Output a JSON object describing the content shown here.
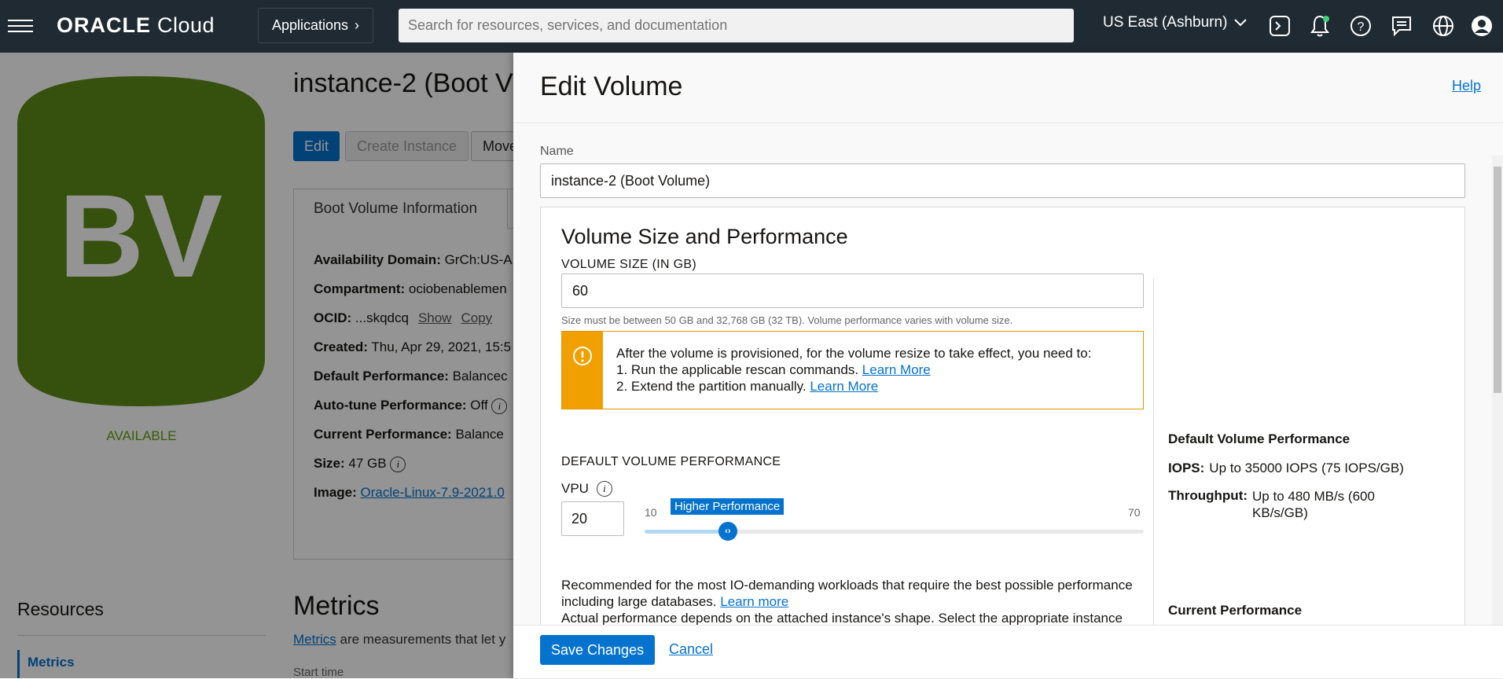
{
  "topbar": {
    "logo_bold": "ORACLE",
    "logo_rest": " Cloud",
    "applications_label": "Applications",
    "search_placeholder": "Search for resources, services, and documentation",
    "region": "US East (Ashburn)",
    "icons": [
      "cloud-shell-icon",
      "bell-icon",
      "help-icon",
      "chat-icon",
      "globe-icon",
      "user-icon"
    ]
  },
  "page": {
    "badge_text": "BV",
    "badge_color": "#5e8a17",
    "status": "AVAILABLE",
    "title": "instance-2 (Boot V",
    "buttons": {
      "edit": "Edit",
      "create_instance": "Create Instance",
      "move": "Move"
    },
    "tab": "Boot Volume Information",
    "info": {
      "ad_label": "Availability Domain:",
      "ad_value": " GrCh:US-A",
      "compartment_label": "Compartment:",
      "compartment_value": " ociobenablemen",
      "ocid_label": "OCID:",
      "ocid_value": " ...skqdcq",
      "ocid_show": "Show",
      "ocid_copy": "Copy",
      "created_label": "Created:",
      "created_value": " Thu, Apr 29, 2021, 15:5",
      "default_perf_label": "Default Performance:",
      "default_perf_value": " Balancec",
      "autotune_label": "Auto-tune Performance:",
      "autotune_value": " Off",
      "current_perf_label": "Current Performance:",
      "current_perf_value": " Balance",
      "size_label": "Size:",
      "size_value": " 47 GB",
      "image_label": "Image:",
      "image_value": "Oracle-Linux-7.9-2021.0"
    },
    "resources": "Resources",
    "resources_metrics": "Metrics",
    "metrics_heading": "Metrics",
    "metrics_link": "Metrics",
    "metrics_text": " are measurements that let y",
    "start_time": "Start time"
  },
  "drawer": {
    "title": "Edit Volume",
    "help": "Help",
    "name_label": "Name",
    "name_value": "instance-2 (Boot Volume)",
    "card_title": "Volume Size and Performance",
    "size_label": "VOLUME SIZE (IN GB)",
    "size_value": "60",
    "size_hint": "Size must be between 50 GB and 32,768 GB (32 TB). Volume performance varies with volume size.",
    "warning": {
      "line1": "After the volume is provisioned, for the volume resize to take effect, you need to:",
      "line2": "1. Run the applicable rescan commands. ",
      "line2_link": "Learn More",
      "line3": "2. Extend the partition manually. ",
      "line3_link": "Learn More"
    },
    "perf_label": "DEFAULT VOLUME PERFORMANCE",
    "vpu_label": "VPU",
    "vpu_value": "20",
    "slider": {
      "min": 10,
      "max": 70,
      "value": 20,
      "tooltip": "Higher Performance"
    },
    "rec_text_1": "Recommended for the most IO-demanding workloads that require the best possible performance including large databases. ",
    "rec_link": "Learn more",
    "rec_text_2": "Actual performance depends on the attached instance's shape. Select the appropriate instance",
    "side": {
      "default_title": "Default Volume Performance",
      "iops_label": "IOPS:",
      "iops_value": "Up to 35000 IOPS (75 IOPS/GB)",
      "throughput_label": "Throughput:",
      "throughput_value": "Up to 480 MB/s (600 KB/s/GB)",
      "current_title": "Current Performance"
    },
    "save": "Save Changes",
    "cancel": "Cancel"
  }
}
